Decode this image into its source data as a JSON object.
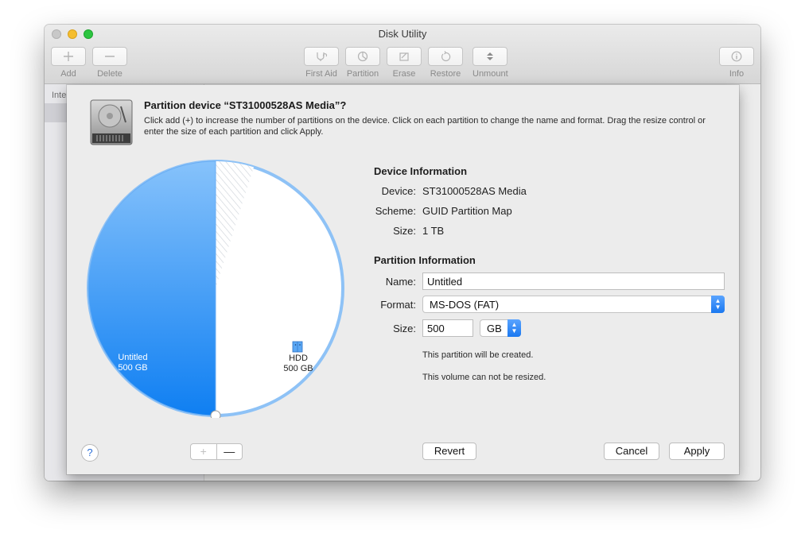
{
  "window": {
    "title": "Disk Utility"
  },
  "toolbar": {
    "add": "Add",
    "delete": "Delete",
    "first_aid": "First Aid",
    "partition": "Partition",
    "erase": "Erase",
    "restore": "Restore",
    "unmount": "Unmount",
    "info": "Info"
  },
  "sidebar": {
    "section_header": "Inte"
  },
  "sheet": {
    "title": "Partition device “ST31000528AS Media”?",
    "description": "Click add (+) to increase the number of partitions on the device. Click on each partition to change the name and format. Drag the resize control or enter the size of each partition and click Apply."
  },
  "pie": {
    "slices": [
      {
        "name": "Untitled",
        "size": "500 GB",
        "fraction": 0.5,
        "color": "#1e86f3"
      },
      {
        "name": "HDD",
        "size": "500 GB",
        "fraction": 0.5,
        "color": "#ffffff"
      }
    ],
    "used_fraction_hdd": 0.07
  },
  "device_info": {
    "heading": "Device Information",
    "device_label": "Device:",
    "device_value": "ST31000528AS Media",
    "scheme_label": "Scheme:",
    "scheme_value": "GUID Partition Map",
    "size_label": "Size:",
    "size_value": "1 TB"
  },
  "partition_info": {
    "heading": "Partition Information",
    "name_label": "Name:",
    "name_value": "Untitled",
    "format_label": "Format:",
    "format_value": "MS-DOS (FAT)",
    "size_label": "Size:",
    "size_value": "500",
    "unit_value": "GB",
    "note_created": "This partition will be created.",
    "note_resize": "This volume can not be resized."
  },
  "buttons": {
    "help": "?",
    "add_partition": "+",
    "remove_partition": "—",
    "revert": "Revert",
    "cancel": "Cancel",
    "apply": "Apply"
  },
  "colors": {
    "accent": "#1e86f3",
    "pie_border": "#8ec2f6"
  }
}
